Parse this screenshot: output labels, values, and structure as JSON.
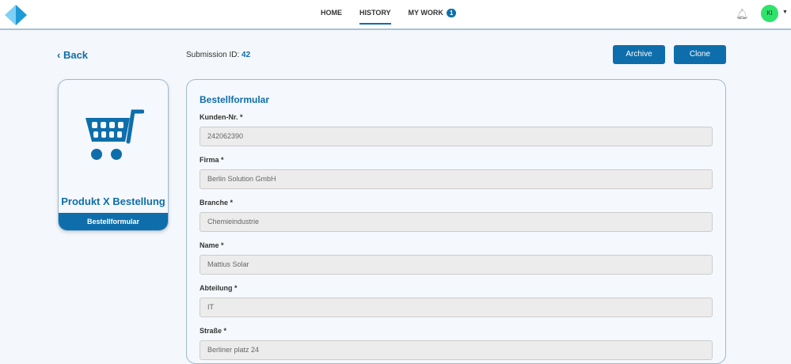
{
  "nav": {
    "items": [
      "HOME",
      "HISTORY",
      "MY WORK"
    ],
    "badge": "1"
  },
  "user": {
    "initials": "KI"
  },
  "back": "Back",
  "submission": {
    "label": "Submission ID:",
    "id": "42"
  },
  "actions": {
    "archive": "Archive",
    "clone": "Clone"
  },
  "card": {
    "title": "Produkt X Bestellung",
    "footer": "Bestellformular"
  },
  "form": {
    "title": "Bestellformular",
    "fields": [
      {
        "label": "Kunden-Nr. *",
        "value": "242062390"
      },
      {
        "label": "Firma *",
        "value": "Berlin Solution GmbH"
      },
      {
        "label": "Branche *",
        "value": "Chemieindustrie"
      },
      {
        "label": "Name *",
        "value": "Mattius Solar"
      },
      {
        "label": "Abteilung *",
        "value": "IT"
      },
      {
        "label": "Straße *",
        "value": "Berliner platz 24"
      }
    ]
  }
}
